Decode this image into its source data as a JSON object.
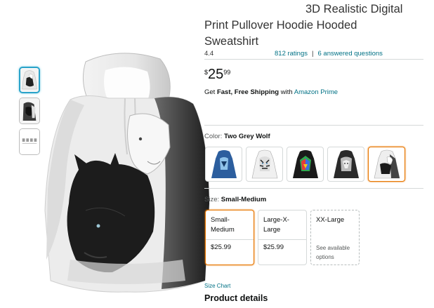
{
  "product": {
    "title_line1": "3D Realistic Digital",
    "title_line2": "Print Pullover Hoodie Hooded",
    "title_line3": "Sweatshirt",
    "rating": "4.4",
    "ratings_link": "812 ratings",
    "separator": "|",
    "questions_link": "6 answered questions",
    "price": {
      "symbol": "$",
      "whole": "25",
      "fraction": "99"
    },
    "shipping": {
      "prefix": "Get ",
      "bold": "Fast, Free Shipping",
      "middle": " with ",
      "link": "Amazon Prime"
    }
  },
  "thumbnails": [
    {
      "icon": "wolf-hoodie-front-icon",
      "selected": true
    },
    {
      "icon": "wolf-hoodie-side-icon",
      "selected": false
    },
    {
      "icon": "size-chart-thumb-icon",
      "selected": false
    }
  ],
  "color": {
    "label": "Color: ",
    "selected": "Two Grey Wolf",
    "options": [
      {
        "icon": "blue-wolf-hoodie-icon",
        "accent": "#2f5f9e"
      },
      {
        "icon": "white-tiger-hoodie-icon",
        "accent": "#9a9a9a"
      },
      {
        "icon": "colorful-wolf-hoodie-icon",
        "accent": "#2fa84f"
      },
      {
        "icon": "grey-wolf-hoodie-icon",
        "accent": "#555555"
      },
      {
        "icon": "two-grey-wolf-hoodie-icon",
        "accent": "#333333",
        "selected": true
      }
    ]
  },
  "size": {
    "label": "Size: ",
    "selected": "Small-Medium",
    "options": [
      {
        "name_line1": "Small-",
        "name_line2": "Medium",
        "price": "$25.99",
        "selected": true
      },
      {
        "name_line1": "Large-X-",
        "name_line2": "Large",
        "price": "$25.99"
      },
      {
        "name_line1": "XX-Large",
        "name_line2": "",
        "availability_line1": "See available",
        "availability_line2": "options"
      }
    ]
  },
  "links": {
    "size_chart": "Size Chart"
  },
  "sections": {
    "product_details": "Product details"
  },
  "colors": {
    "link": "#007185",
    "selected_border": "#e77600",
    "thumb_selected": "#2aa3c9"
  }
}
